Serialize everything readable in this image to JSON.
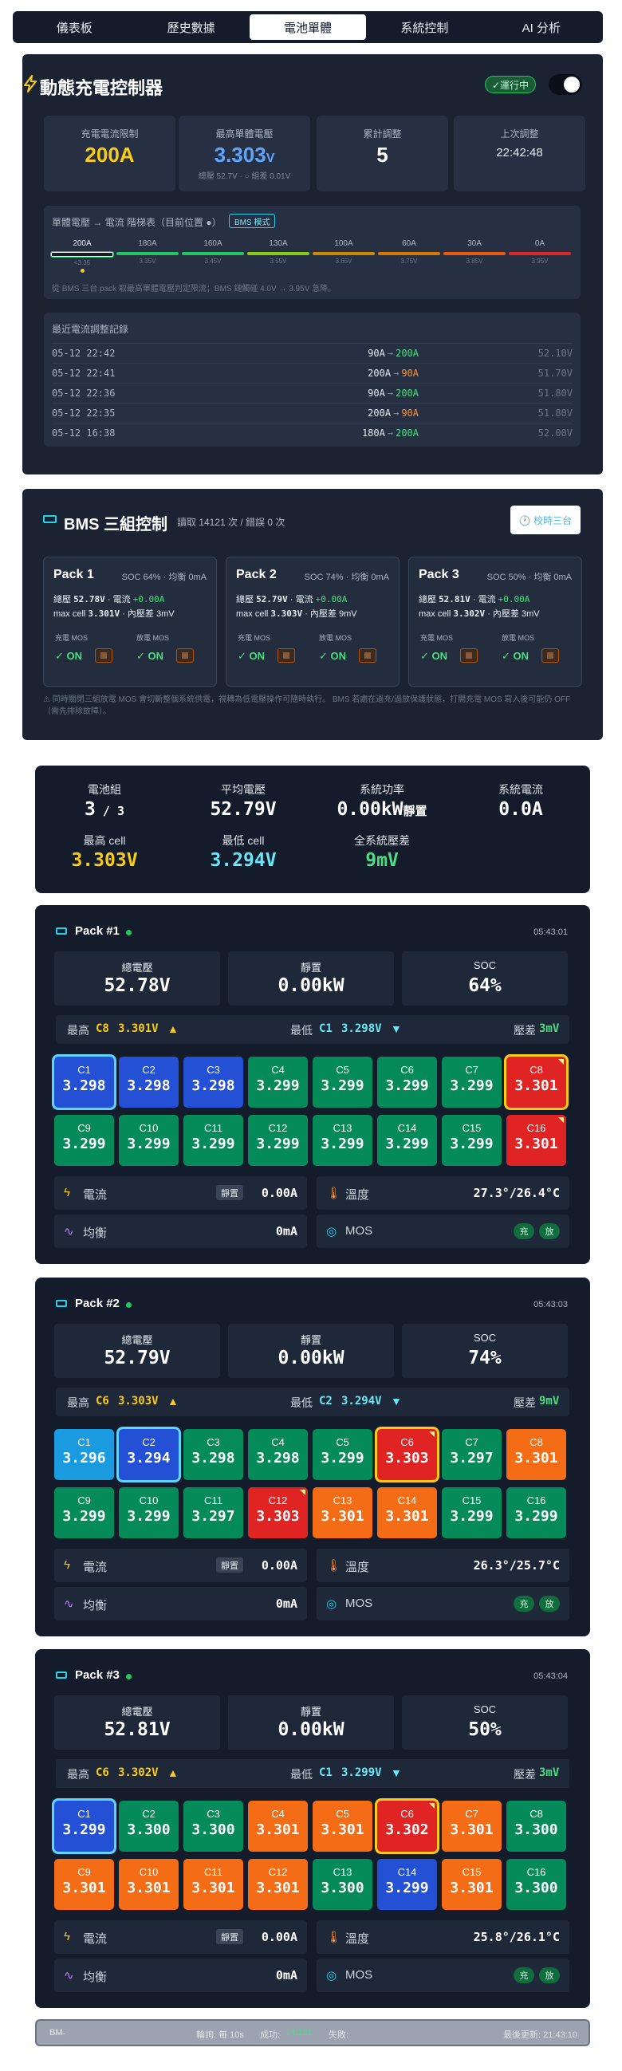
{
  "tabs": [
    {
      "label": "儀表板"
    },
    {
      "label": "歷史數據"
    },
    {
      "label": "電池單體"
    },
    {
      "label": "系統控制"
    },
    {
      "label": "AI 分析"
    }
  ],
  "controller": {
    "title": "動態充電控制器",
    "status": "✓運行中",
    "stats": [
      {
        "label": "充電電流限制",
        "value": "200A",
        "color": "#facc15"
      },
      {
        "label": "最高單體電壓",
        "value": "3.303",
        "unit": "V",
        "sub": "總壓 52.7V · ○ 組差 0.01V",
        "color": "#60a5fa"
      },
      {
        "label": "累計調整",
        "value": "5",
        "color": "#ffffff"
      },
      {
        "label": "上次調整",
        "value": "22:42:48",
        "color": "#e6edf3"
      }
    ],
    "ladder": {
      "heading": "單體電壓 → 電流 階梯表（目前位置 ●）",
      "mode": "BMS 模式",
      "steps": [
        {
          "amps": "200A",
          "volt": "<3.35",
          "color": "#e6edf3",
          "active": true
        },
        {
          "amps": "180A",
          "volt": "3.35V",
          "color": "#22c55e"
        },
        {
          "amps": "160A",
          "volt": "3.45V",
          "color": "#22c55e"
        },
        {
          "amps": "130A",
          "volt": "3.55V",
          "color": "#84cc16"
        },
        {
          "amps": "100A",
          "volt": "3.65V",
          "color": "#ca8a04"
        },
        {
          "amps": "60A",
          "volt": "3.75V",
          "color": "#d97706"
        },
        {
          "amps": "30A",
          "volt": "3.85V",
          "color": "#ea580c"
        },
        {
          "amps": "0A",
          "volt": "3.95V",
          "color": "#dc2626"
        }
      ],
      "note": "從 BMS 三台 pack 取最高單體電壓判定限流；BMS 鏈觸碰 4.0V → 3.95V 急降。"
    },
    "log": {
      "heading": "最近電流調整記錄",
      "rows": [
        {
          "time": "05-12 22:42",
          "from": "90A",
          "to": "200A",
          "to_color": "#4ade80",
          "volt": "52.10V"
        },
        {
          "time": "05-12 22:41",
          "from": "200A",
          "to": "90A",
          "to_color": "#fb923c",
          "volt": "51.70V"
        },
        {
          "time": "05-12 22:36",
          "from": "90A",
          "to": "200A",
          "to_color": "#4ade80",
          "volt": "51.80V"
        },
        {
          "time": "05-12 22:35",
          "from": "200A",
          "to": "90A",
          "to_color": "#fb923c",
          "volt": "51.80V"
        },
        {
          "time": "05-12 16:38",
          "from": "180A",
          "to": "200A",
          "to_color": "#4ade80",
          "volt": "52.00V"
        }
      ]
    }
  },
  "bms": {
    "title": "BMS 三組控制",
    "subtitle": "讀取 14121 次 / 錯誤 0 次",
    "reset_label": "🕐 校時三台",
    "mos_charge_label": "充電 MOS",
    "mos_discharge_label": "放電 MOS",
    "mos_on": "✓ ON",
    "packs": [
      {
        "name": "Pack 1",
        "summary": "SOC 64% · 均衡 0mA",
        "total": "52.78V",
        "current": "+0.00A",
        "maxcell": "3.301V",
        "diff": "3mV"
      },
      {
        "name": "Pack 2",
        "summary": "SOC 74% · 均衡 0mA",
        "total": "52.79V",
        "current": "+0.00A",
        "maxcell": "3.303V",
        "diff": "9mV"
      },
      {
        "name": "Pack 3",
        "summary": "SOC 50% · 均衡 0mA",
        "total": "52.81V",
        "current": "+0.00A",
        "maxcell": "3.302V",
        "diff": "3mV"
      }
    ],
    "note": "⚠ 同時關閉三組放電 MOS 會切斷整個系統供電，視轉為低電壓操作可隨時執行。 BMS 若處在過充/過放保護狀態，打開充電 MOS 寫入後可能仍 OFF（需先排除故障）。"
  },
  "summary": {
    "items": [
      {
        "label": "電池組",
        "value": "3",
        "suffix": " / 3",
        "color": "#ffffff"
      },
      {
        "label": "平均電壓",
        "value": "52.79V",
        "color": "#ffffff"
      },
      {
        "label": "系統功率",
        "value": "0.00kW",
        "suffix": "靜置",
        "color": "#ffffff"
      },
      {
        "label": "系統電流",
        "value": "0.0A",
        "color": "#ffffff"
      },
      {
        "label": "最高 cell",
        "value": "3.303V",
        "color": "#facc15"
      },
      {
        "label": "最低 cell",
        "value": "3.294V",
        "color": "#67e8f9"
      },
      {
        "label": "全系統壓差",
        "value": "9mV",
        "color": "#4ade80"
      }
    ]
  },
  "labels": {
    "total_v": "總電壓",
    "power_state": "靜置",
    "soc": "SOC",
    "max": "最高",
    "min": "最低",
    "diff": "壓差",
    "current": "電流",
    "temp": "溫度",
    "balance": "均衡",
    "mos": "MOS",
    "idle": "靜置",
    "charge": "充",
    "discharge": "放"
  },
  "pack_details": [
    {
      "name": "Pack #1",
      "time": "05:43:01",
      "total": "52.78V",
      "power": "0.00kW",
      "soc": "64%",
      "max_cell": "C8",
      "max_v": "3.301V",
      "min_cell": "C1",
      "min_v": "3.298V",
      "diff": "3mV",
      "current": "0.00A",
      "temp": "27.3°/26.4°C",
      "balance": "0mA",
      "cells": [
        {
          "n": "C1",
          "v": "3.298",
          "c": "blue",
          "hl": "min"
        },
        {
          "n": "C2",
          "v": "3.298",
          "c": "blue"
        },
        {
          "n": "C3",
          "v": "3.298",
          "c": "blue"
        },
        {
          "n": "C4",
          "v": "3.299",
          "c": "green"
        },
        {
          "n": "C5",
          "v": "3.299",
          "c": "green"
        },
        {
          "n": "C6",
          "v": "3.299",
          "c": "green"
        },
        {
          "n": "C7",
          "v": "3.299",
          "c": "green"
        },
        {
          "n": "C8",
          "v": "3.301",
          "c": "red",
          "hl": "max"
        },
        {
          "n": "C9",
          "v": "3.299",
          "c": "green"
        },
        {
          "n": "C10",
          "v": "3.299",
          "c": "green"
        },
        {
          "n": "C11",
          "v": "3.299",
          "c": "green"
        },
        {
          "n": "C12",
          "v": "3.299",
          "c": "green"
        },
        {
          "n": "C13",
          "v": "3.299",
          "c": "green"
        },
        {
          "n": "C14",
          "v": "3.299",
          "c": "green"
        },
        {
          "n": "C15",
          "v": "3.299",
          "c": "green"
        },
        {
          "n": "C16",
          "v": "3.301",
          "c": "red"
        }
      ]
    },
    {
      "name": "Pack #2",
      "time": "05:43:03",
      "total": "52.79V",
      "power": "0.00kW",
      "soc": "74%",
      "max_cell": "C6",
      "max_v": "3.303V",
      "min_cell": "C2",
      "min_v": "3.294V",
      "diff": "9mV",
      "current": "0.00A",
      "temp": "26.3°/25.7°C",
      "balance": "0mA",
      "cells": [
        {
          "n": "C1",
          "v": "3.296",
          "c": "sky"
        },
        {
          "n": "C2",
          "v": "3.294",
          "c": "blue",
          "hl": "min"
        },
        {
          "n": "C3",
          "v": "3.298",
          "c": "green"
        },
        {
          "n": "C4",
          "v": "3.298",
          "c": "green"
        },
        {
          "n": "C5",
          "v": "3.299",
          "c": "green"
        },
        {
          "n": "C6",
          "v": "3.303",
          "c": "red",
          "hl": "max"
        },
        {
          "n": "C7",
          "v": "3.297",
          "c": "green"
        },
        {
          "n": "C8",
          "v": "3.301",
          "c": "orange"
        },
        {
          "n": "C9",
          "v": "3.299",
          "c": "green"
        },
        {
          "n": "C10",
          "v": "3.299",
          "c": "green"
        },
        {
          "n": "C11",
          "v": "3.297",
          "c": "green"
        },
        {
          "n": "C12",
          "v": "3.303",
          "c": "red"
        },
        {
          "n": "C13",
          "v": "3.301",
          "c": "orange"
        },
        {
          "n": "C14",
          "v": "3.301",
          "c": "orange"
        },
        {
          "n": "C15",
          "v": "3.299",
          "c": "green"
        },
        {
          "n": "C16",
          "v": "3.299",
          "c": "green"
        }
      ]
    },
    {
      "name": "Pack #3",
      "time": "05:43:04",
      "total": "52.81V",
      "power": "0.00kW",
      "soc": "50%",
      "max_cell": "C6",
      "max_v": "3.302V",
      "min_cell": "C1",
      "min_v": "3.299V",
      "diff": "3mV",
      "current": "0.00A",
      "temp": "25.8°/26.1°C",
      "balance": "0mA",
      "cells": [
        {
          "n": "C1",
          "v": "3.299",
          "c": "blue",
          "hl": "min"
        },
        {
          "n": "C2",
          "v": "3.300",
          "c": "green"
        },
        {
          "n": "C3",
          "v": "3.300",
          "c": "green"
        },
        {
          "n": "C4",
          "v": "3.301",
          "c": "orange"
        },
        {
          "n": "C5",
          "v": "3.301",
          "c": "orange"
        },
        {
          "n": "C6",
          "v": "3.302",
          "c": "red",
          "hl": "max"
        },
        {
          "n": "C7",
          "v": "3.301",
          "c": "orange"
        },
        {
          "n": "C8",
          "v": "3.300",
          "c": "green"
        },
        {
          "n": "C9",
          "v": "3.301",
          "c": "orange"
        },
        {
          "n": "C10",
          "v": "3.301",
          "c": "orange"
        },
        {
          "n": "C11",
          "v": "3.301",
          "c": "orange"
        },
        {
          "n": "C12",
          "v": "3.301",
          "c": "orange"
        },
        {
          "n": "C13",
          "v": "3.300",
          "c": "green"
        },
        {
          "n": "C14",
          "v": "3.299",
          "c": "blue"
        },
        {
          "n": "C15",
          "v": "3.301",
          "c": "orange"
        },
        {
          "n": "C16",
          "v": "3.300",
          "c": "green"
        }
      ]
    }
  ],
  "footer": {
    "left": "B̶M̶",
    "interval": "輪詢: 每 10s",
    "success_label": "成功:",
    "success_count": "14,121",
    "fail_label": "失敗:",
    "updated": "最後更新: 21:43:10"
  }
}
